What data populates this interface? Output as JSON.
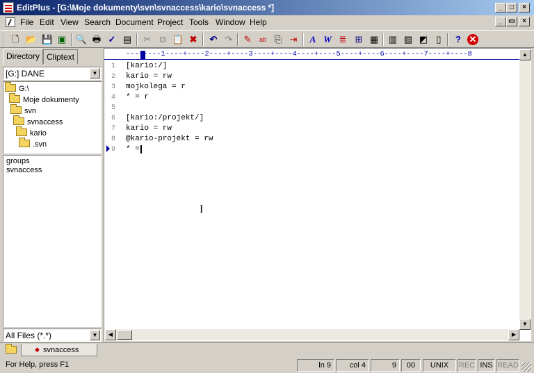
{
  "window": {
    "title": "EditPlus - [G:\\Moje dokumenty\\svn\\svnaccess\\kario\\svnaccess *]",
    "caption_buttons": [
      "_",
      "□",
      "×"
    ],
    "mdi_buttons": [
      "_",
      "▭",
      "×"
    ]
  },
  "menu": {
    "items": [
      "File",
      "Edit",
      "View",
      "Search",
      "Document",
      "Project",
      "Tools",
      "Window",
      "Help"
    ]
  },
  "toolbar": {
    "buttons": [
      {
        "icon": "new-file-icon",
        "glyph": "🗋"
      },
      {
        "icon": "open-folder-icon",
        "glyph": "📂"
      },
      {
        "icon": "save-icon",
        "glyph": "💾"
      },
      {
        "icon": "save-all-icon",
        "glyph": "▣"
      },
      {
        "icon": "print-preview-icon",
        "glyph": "🔍"
      },
      {
        "icon": "print-icon",
        "glyph": "🖶"
      },
      {
        "icon": "spell-check-icon",
        "glyph": "✓"
      },
      {
        "icon": "html-preview-icon",
        "glyph": "▤"
      },
      {
        "icon": "cut-icon",
        "glyph": "✂"
      },
      {
        "icon": "copy-icon",
        "glyph": "⧉"
      },
      {
        "icon": "paste-icon",
        "glyph": "📋"
      },
      {
        "icon": "delete-icon",
        "glyph": "✖"
      },
      {
        "icon": "undo-icon",
        "glyph": "↶"
      },
      {
        "icon": "redo-icon",
        "glyph": "↷"
      },
      {
        "icon": "find-icon",
        "glyph": "✎"
      },
      {
        "icon": "replace-icon",
        "glyph": "ab"
      },
      {
        "icon": "find-in-files-icon",
        "glyph": "⎘"
      },
      {
        "icon": "goto-line-icon",
        "glyph": "⇥"
      },
      {
        "icon": "font-icon",
        "glyph": "A"
      },
      {
        "icon": "word-wrap-icon",
        "glyph": "W"
      },
      {
        "icon": "line-number-icon",
        "glyph": "≣"
      },
      {
        "icon": "column-select-icon",
        "glyph": "⊞"
      },
      {
        "icon": "ruler-icon",
        "glyph": "▦"
      },
      {
        "icon": "directory-window-icon",
        "glyph": "▥"
      },
      {
        "icon": "output-window-icon",
        "glyph": "▧"
      },
      {
        "icon": "browser-icon",
        "glyph": "◩"
      },
      {
        "icon": "cliptext-icon",
        "glyph": "▯"
      },
      {
        "icon": "help-icon",
        "glyph": "?"
      },
      {
        "icon": "stop-icon",
        "glyph": "✕"
      }
    ]
  },
  "sidebar": {
    "tabs": [
      "Directory",
      "Cliptext"
    ],
    "active_tab": "Directory",
    "drive": "[G:] DANE",
    "tree": [
      {
        "label": "G:\\",
        "level": 0
      },
      {
        "label": "Moje dokumenty",
        "level": 1
      },
      {
        "label": "svn",
        "level": 2
      },
      {
        "label": "svnaccess",
        "level": 3
      },
      {
        "label": "kario",
        "level": 4
      },
      {
        "label": ".svn",
        "level": 5
      }
    ],
    "files": [
      "groups",
      "svnaccess"
    ],
    "filter": "All Files (*.*)"
  },
  "editor": {
    "ruler": "---+----1----+----2----+----3----+----4----+----5----+----6----+----7----+----8",
    "lines": [
      {
        "num": "1",
        "text": "[kario:/]"
      },
      {
        "num": "2",
        "text": "kario = rw"
      },
      {
        "num": "3",
        "text": "mojkolega = r"
      },
      {
        "num": "4",
        "text": "* = r"
      },
      {
        "num": "5",
        "text": ""
      },
      {
        "num": "6",
        "text": "[kario:/projekt/]"
      },
      {
        "num": "7",
        "text": "kario = rw"
      },
      {
        "num": "8",
        "text": "@kario-projekt = rw"
      },
      {
        "num": "9",
        "text": "* ="
      }
    ]
  },
  "document_tabs": [
    {
      "label": "svnaccess",
      "modified_marker": "◆"
    }
  ],
  "statusbar": {
    "help": "For Help, press F1",
    "line": "ln 9",
    "col": "col 4",
    "count": "9",
    "hex": "00",
    "format": "UNIX",
    "rec": "REC",
    "ins": "INS",
    "read": "READ"
  }
}
